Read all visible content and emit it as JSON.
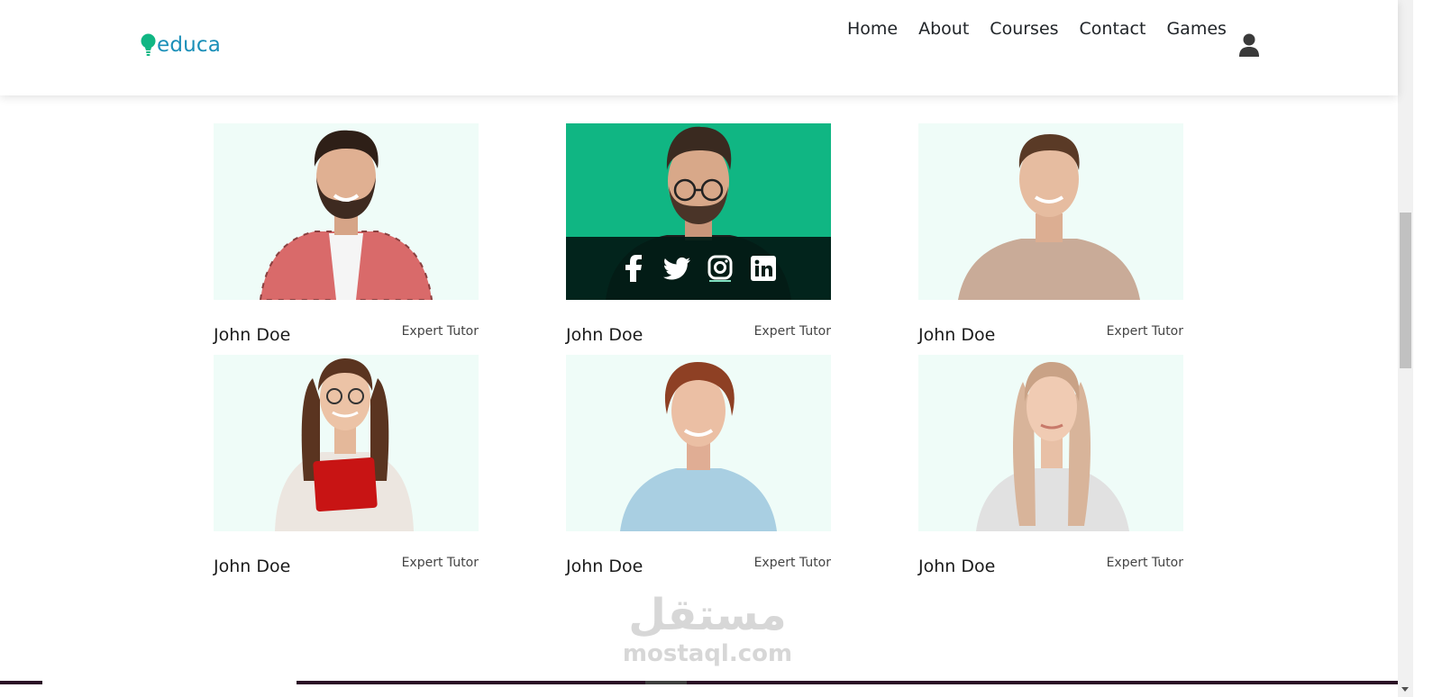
{
  "brand": {
    "name": "educa",
    "logo_color": "#1a8fb8",
    "bulb_color": "#10b683"
  },
  "nav": {
    "items": [
      "Home",
      "About",
      "Courses",
      "Contact",
      "Games"
    ],
    "user_icon": "user-icon"
  },
  "team": [
    {
      "name": "John Doe",
      "role": "Expert Tutor",
      "photo": "man-plaid-shirt"
    },
    {
      "name": "John Doe",
      "role": "Expert Tutor",
      "photo": "man-glasses-hover",
      "social": [
        "facebook-icon",
        "twitter-icon",
        "instagram-icon",
        "linkedin-icon"
      ]
    },
    {
      "name": "John Doe",
      "role": "Expert Tutor",
      "photo": "man-beige-sweater"
    },
    {
      "name": "John Doe",
      "role": "Expert Tutor",
      "photo": "woman-glasses-red-book"
    },
    {
      "name": "John Doe",
      "role": "Expert Tutor",
      "photo": "woman-short-hair"
    },
    {
      "name": "John Doe",
      "role": "Expert Tutor",
      "photo": "woman-long-blonde-hair"
    }
  ],
  "colors": {
    "accent": "#10b683",
    "card_bg": "#effcf8",
    "overlay": "#021c16"
  },
  "watermark": {
    "arabic": "مستقل",
    "latin": "mostaql.com"
  }
}
